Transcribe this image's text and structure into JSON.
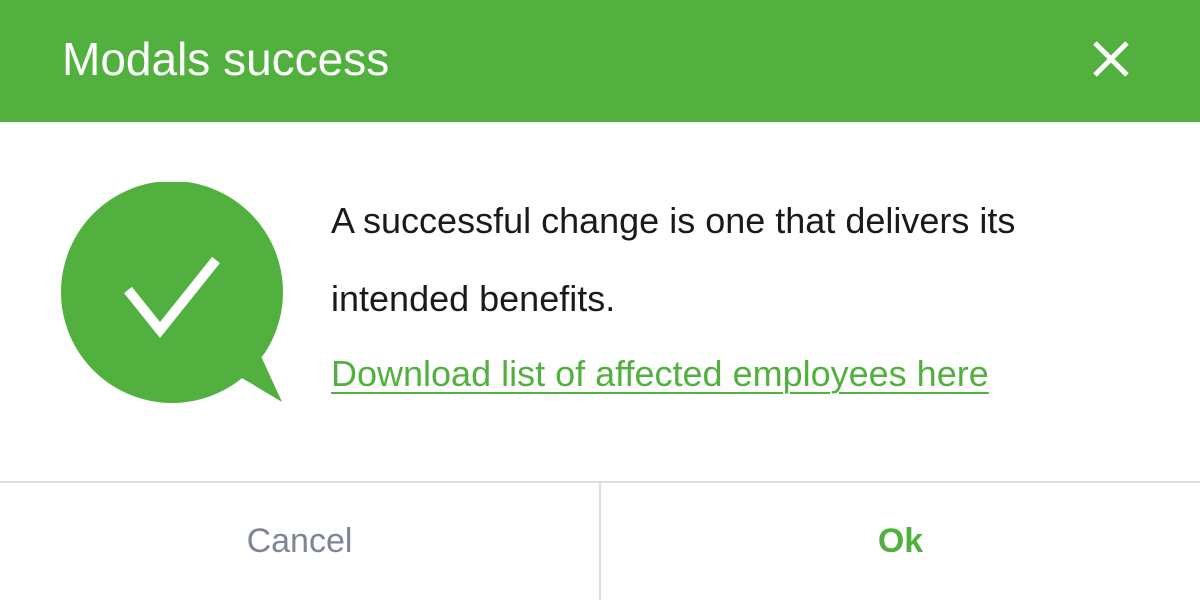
{
  "modal": {
    "title": "Modals success",
    "message": "A successful change is one that delivers its intended benefits.",
    "link_text": "Download list of affected employees here",
    "icons": {
      "close": "close-icon",
      "success": "check-speech-bubble-icon"
    }
  },
  "footer": {
    "cancel_label": "Cancel",
    "ok_label": "Ok"
  },
  "colors": {
    "accent": "#52b03f",
    "header_text": "#ffffff",
    "body_text": "#1a1a1a",
    "cancel_text": "#7d8596",
    "divider": "#dcdde0"
  }
}
